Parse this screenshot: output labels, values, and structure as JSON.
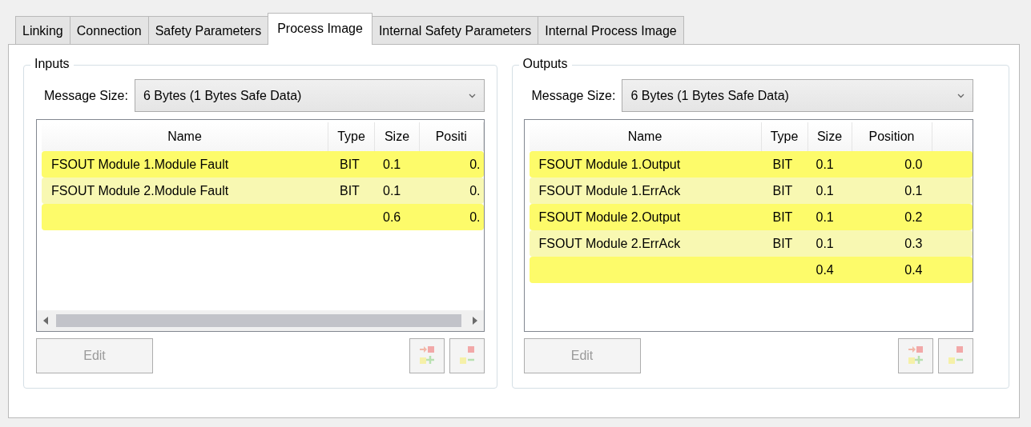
{
  "tabs": [
    {
      "label": "Linking",
      "selected": false
    },
    {
      "label": "Connection",
      "selected": false
    },
    {
      "label": "Safety Parameters",
      "selected": false
    },
    {
      "label": "Process Image",
      "selected": true
    },
    {
      "label": "Internal Safety Parameters",
      "selected": false
    },
    {
      "label": "Internal Process Image",
      "selected": false
    }
  ],
  "groups": [
    {
      "title": "Inputs",
      "message_size_label": "Message Size:",
      "message_size": "6 Bytes (1 Bytes Safe Data)",
      "columns": [
        "Name",
        "Type",
        "Size",
        "Positi"
      ],
      "rows": [
        [
          "FSOUT Module 1.Module Fault",
          "BIT",
          "0.1",
          "0."
        ],
        [
          "FSOUT Module 2.Module Fault",
          "BIT",
          "0.1",
          "0."
        ],
        [
          "",
          "",
          "0.6",
          "0."
        ]
      ],
      "horizontal_scrollbar": true,
      "edit_button": {
        "label": "Edit",
        "disabled": true
      }
    },
    {
      "title": "Outputs",
      "message_size_label": "Message Size:",
      "message_size": "6 Bytes (1 Bytes Safe Data)",
      "columns": [
        "Name",
        "Type",
        "Size",
        "Position"
      ],
      "rows": [
        [
          "FSOUT Module 1.Output",
          "BIT",
          "0.1",
          "0.0"
        ],
        [
          "FSOUT Module 1.ErrAck",
          "BIT",
          "0.1",
          "0.1"
        ],
        [
          "FSOUT Module 2.Output",
          "BIT",
          "0.1",
          "0.2"
        ],
        [
          "FSOUT Module 2.ErrAck",
          "BIT",
          "0.1",
          "0.3"
        ],
        [
          "",
          "",
          "0.4",
          "0.4"
        ]
      ],
      "horizontal_scrollbar": false,
      "edit_button": {
        "label": "Edit",
        "disabled": true
      }
    }
  ]
}
